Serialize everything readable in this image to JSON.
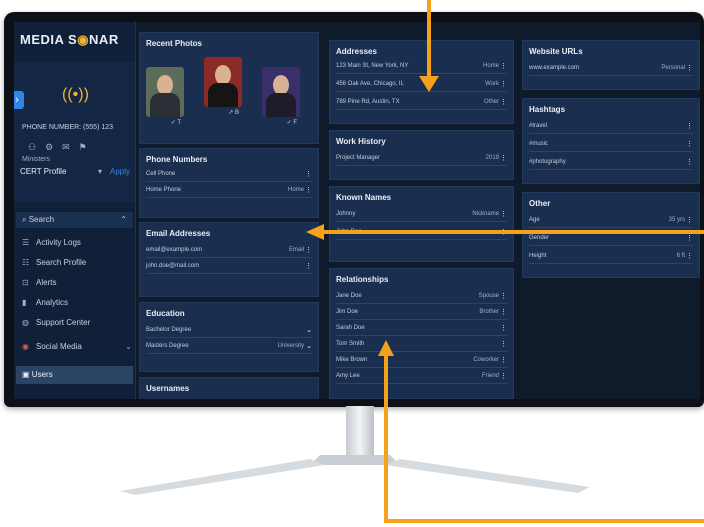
{
  "brand": {
    "name_a": "MEDIA S",
    "name_dot": "◉",
    "name_b": "NAR"
  },
  "sidebar": {
    "line1": "PHONE NUMBER: (555) 123",
    "line2": "Ministers",
    "select_value": "CERT Profile",
    "select_link": "Apply",
    "search_label": "Search",
    "items": [
      {
        "icon": "☰",
        "label": "Activity Logs"
      },
      {
        "icon": "☷",
        "label": "Search Profile"
      },
      {
        "icon": "⊡",
        "label": "Alerts"
      },
      {
        "icon": "▮",
        "label": "Analytics"
      },
      {
        "icon": "◍",
        "label": "Support Center"
      }
    ],
    "social_label": "Social Media",
    "bottom_label": "Users"
  },
  "cards": {
    "recent_photos": {
      "title": "Recent Photos"
    },
    "phone_numbers": {
      "title": "Phone Numbers",
      "rows": [
        {
          "label": "Cell Phone",
          "value": ""
        },
        {
          "label": "Home Phone",
          "value": "Home"
        }
      ]
    },
    "email_addresses": {
      "title": "Email Addresses",
      "rows": [
        {
          "label": "email@example.com",
          "value": "Email"
        },
        {
          "label": "john.doe@mail.com",
          "value": ""
        }
      ]
    },
    "education": {
      "title": "Education",
      "rows": [
        {
          "label": "Bachelor Degree",
          "value": ""
        },
        {
          "label": "Masters Degree",
          "value": "University"
        }
      ]
    },
    "usernames": {
      "title": "Usernames"
    },
    "addresses": {
      "title": "Addresses",
      "rows": [
        {
          "label": "123 Main St, New York, NY",
          "value": "Home"
        },
        {
          "label": "456 Oak Ave, Chicago, IL",
          "value": "Work"
        },
        {
          "label": "789 Pine Rd, Austin, TX",
          "value": "Other"
        }
      ]
    },
    "work_history": {
      "title": "Work History",
      "rows": [
        {
          "label": "Project Manager",
          "value": "2019"
        }
      ]
    },
    "known_names": {
      "title": "Known Names",
      "rows": [
        {
          "label": "Johnny",
          "value": "Nickname"
        },
        {
          "label": "John Doe",
          "value": ""
        }
      ]
    },
    "relationships": {
      "title": "Relationships",
      "rows": [
        {
          "label": "Jane Doe",
          "value": "Spouse"
        },
        {
          "label": "Jim Doe",
          "value": "Brother"
        },
        {
          "label": "Sarah Doe",
          "value": ""
        },
        {
          "label": "Tom Smith",
          "value": ""
        },
        {
          "label": "Mike Brown",
          "value": "Coworker"
        },
        {
          "label": "Amy Lee",
          "value": "Friend"
        }
      ]
    },
    "website_urls": {
      "title": "Website URLs",
      "rows": [
        {
          "label": "www.example.com",
          "value": "Personal"
        }
      ]
    },
    "hashtags": {
      "title": "Hashtags",
      "rows": [
        {
          "label": "#travel",
          "value": ""
        },
        {
          "label": "#music",
          "value": ""
        },
        {
          "label": "#photography",
          "value": ""
        }
      ]
    },
    "other": {
      "title": "Other",
      "rows": [
        {
          "label": "Age",
          "value": "35 yrs"
        },
        {
          "label": "Gender",
          "value": ""
        },
        {
          "label": "Height",
          "value": "6 ft"
        }
      ]
    }
  },
  "photo_tags": [
    "✓ T",
    "↗ B",
    "✓ F"
  ],
  "colors": {
    "accent": "#f4a11b",
    "link": "#2f86e8",
    "card_bg": "#1a2f4f"
  }
}
